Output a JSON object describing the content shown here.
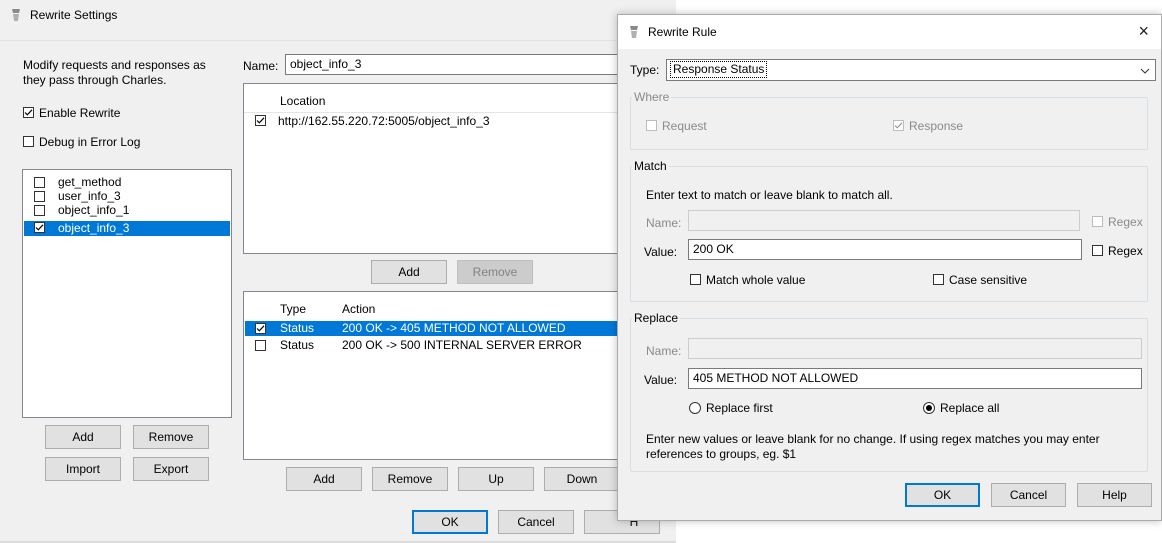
{
  "settings": {
    "title": "Rewrite Settings",
    "description_line1": "Modify requests and responses as",
    "description_line2": "they pass through Charles.",
    "enable_rewrite": "Enable Rewrite",
    "debug_log": "Debug in Error Log",
    "sets": [
      {
        "label": "get_method",
        "checked": false
      },
      {
        "label": "user_info_3",
        "checked": false
      },
      {
        "label": "object_info_1",
        "checked": false
      },
      {
        "label": "object_info_3",
        "checked": true,
        "selected": true
      }
    ],
    "sets_add": "Add",
    "sets_remove": "Remove",
    "sets_import": "Import",
    "sets_export": "Export",
    "name_label": "Name:",
    "name_value": "object_info_3",
    "location_header": "Location",
    "locations": [
      "http://162.55.220.72:5005/object_info_3"
    ],
    "loc_add": "Add",
    "loc_remove": "Remove",
    "rules_header_type": "Type",
    "rules_header_action": "Action",
    "rules": [
      {
        "type": "Status",
        "action": "200 OK -> 405 METHOD NOT ALLOWED",
        "checked": true,
        "selected": true
      },
      {
        "type": "Status",
        "action": "200 OK -> 500 INTERNAL SERVER ERROR",
        "checked": false
      }
    ],
    "rules_add": "Add",
    "rules_remove": "Remove",
    "rules_up": "Up",
    "rules_down": "Down",
    "ok": "OK",
    "cancel": "Cancel",
    "help_partial": "H"
  },
  "rule": {
    "title": "Rewrite Rule",
    "close_glyph": "×",
    "type_label": "Type:",
    "type_value": "Response Status",
    "where_legend": "Where",
    "request": "Request",
    "response": "Response",
    "match_legend": "Match",
    "match_hint": "Enter text to match or leave blank to match all.",
    "name_label": "Name:",
    "value_label": "Value:",
    "regex": "Regex",
    "match_value": "200 OK",
    "match_whole": "Match whole value",
    "case_sensitive": "Case sensitive",
    "replace_legend": "Replace",
    "replace_value": "405 METHOD NOT ALLOWED",
    "replace_first": "Replace first",
    "replace_all": "Replace all",
    "replace_hint_line1": "Enter new values or leave blank for no change. If using regex matches you may enter",
    "replace_hint_line2": "references to groups, eg. $1",
    "ok": "OK",
    "cancel": "Cancel",
    "help": "Help"
  },
  "colors": {
    "selection": "#0078d7",
    "window_bg": "#f0f0f0"
  }
}
